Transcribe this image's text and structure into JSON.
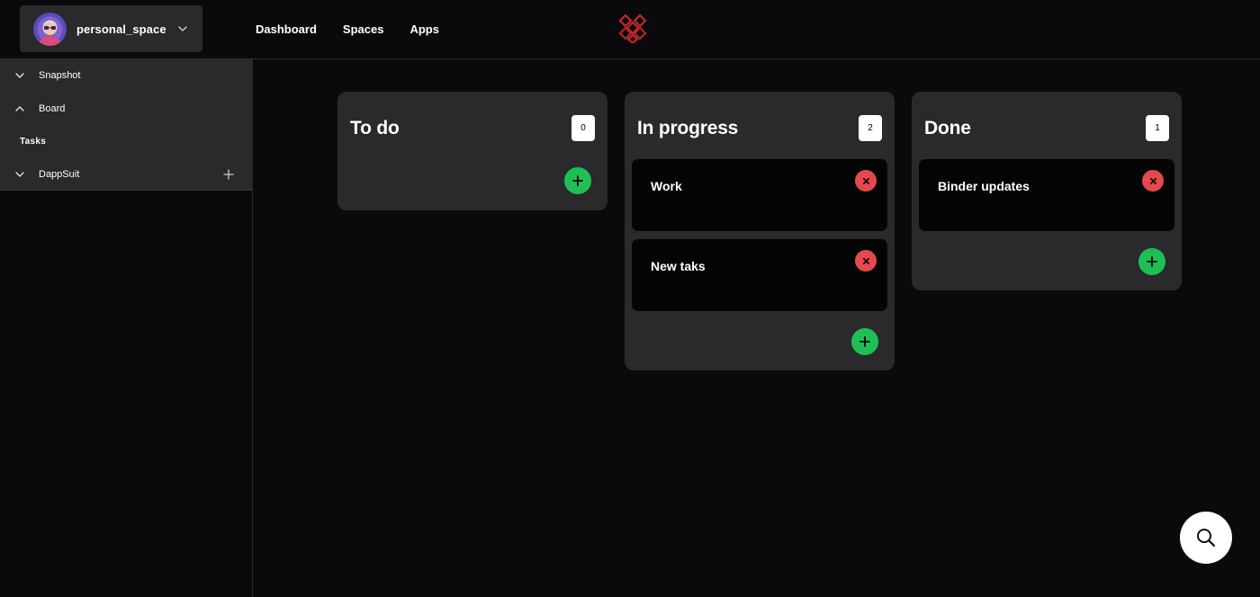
{
  "header": {
    "space_name": "personal_space",
    "nav": [
      "Dashboard",
      "Spaces",
      "Apps"
    ]
  },
  "sidebar": {
    "items": [
      {
        "label": "Snapshot",
        "state": "collapsed"
      },
      {
        "label": "Board",
        "state": "expanded"
      },
      {
        "label": "Tasks",
        "state": "child"
      },
      {
        "label": "DappSuit",
        "state": "collapsed"
      }
    ]
  },
  "board": {
    "columns": [
      {
        "title": "To do",
        "count": "0",
        "cards": []
      },
      {
        "title": "In progress",
        "count": "2",
        "cards": [
          "Work",
          "New taks"
        ]
      },
      {
        "title": "Done",
        "count": "1",
        "cards": [
          "Binder updates"
        ]
      }
    ]
  },
  "colors": {
    "background": "#0a0a0c",
    "panel": "#2a2a2d",
    "card": "#050505",
    "add_button": "#1fbf56",
    "delete_button": "#e5484d",
    "logo": "#c3282b"
  },
  "icons": {
    "space_switcher": "chevron-down-icon",
    "logo": "logo-icon",
    "sidebar_plus": "plus-icon",
    "add_card": "plus-icon",
    "delete_card": "close-icon",
    "search": "search-icon"
  }
}
